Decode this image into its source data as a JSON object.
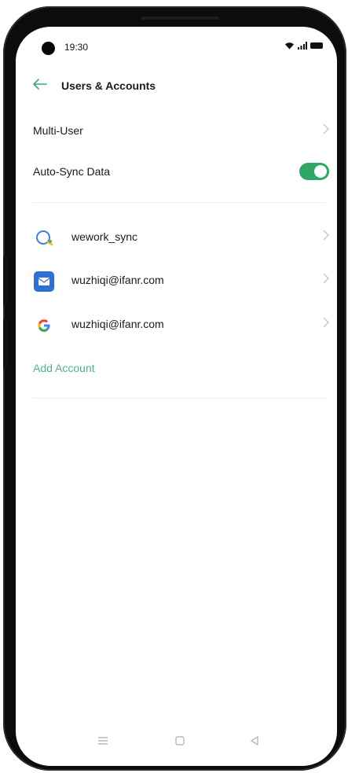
{
  "status_bar": {
    "time": "19:30",
    "signal_icons": "wifi-signal-battery"
  },
  "header": {
    "back_icon": "arrow-left-icon",
    "title": "Users & Accounts"
  },
  "settings": {
    "multi_user": {
      "label": "Multi-User"
    },
    "auto_sync": {
      "label": "Auto-Sync Data",
      "enabled": true
    }
  },
  "accounts": [
    {
      "label": "wework_sync",
      "icon": "wework-icon"
    },
    {
      "label": "wuzhiqi@ifanr.com",
      "icon": "mail-icon"
    },
    {
      "label": "wuzhiqi@ifanr.com",
      "icon": "google-icon"
    }
  ],
  "add_account": {
    "label": "Add Account"
  },
  "nav_bar": {
    "menu_icon": "menu-icon",
    "home_icon": "home-icon",
    "back_icon": "back-triangle-icon"
  },
  "colors": {
    "accent": "#3aa87a",
    "toggle_on": "#2fa866",
    "link": "#4bb884"
  }
}
